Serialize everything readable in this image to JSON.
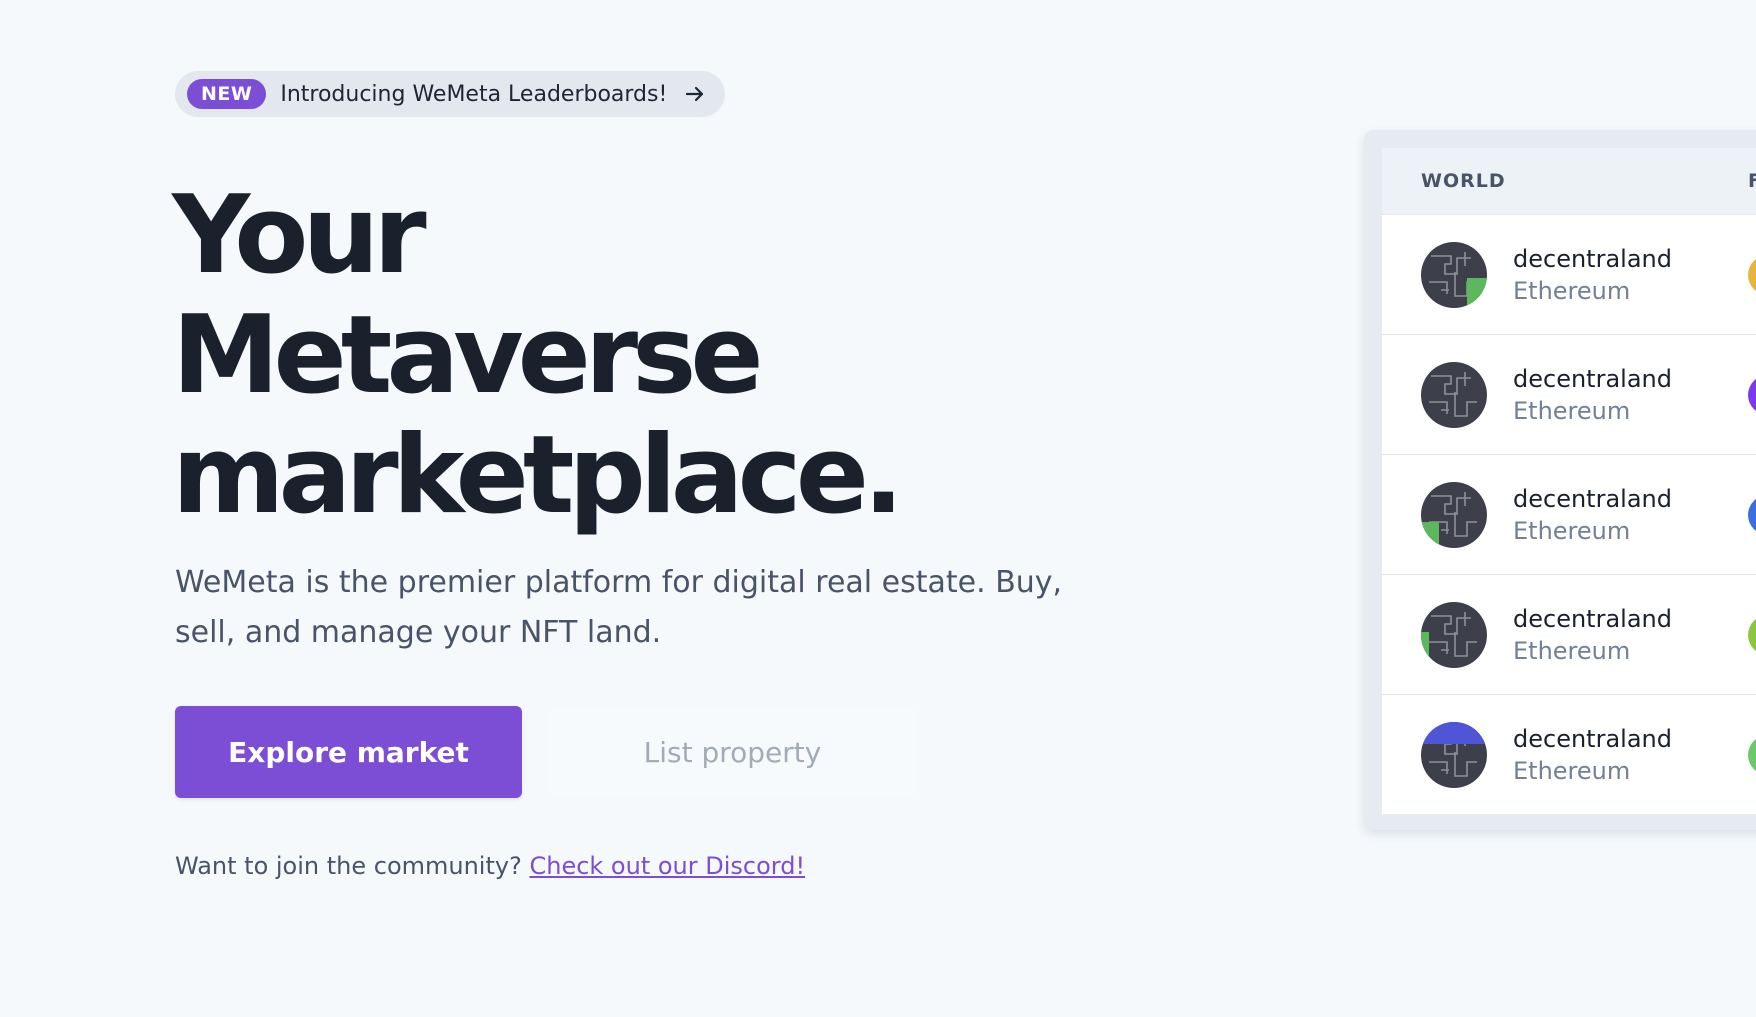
{
  "announcement": {
    "badge": "NEW",
    "text": "Introducing WeMeta Leaderboards!",
    "arrow_icon": "arrow-right-icon"
  },
  "hero": {
    "line1": "Your",
    "line2": "Metaverse",
    "line3": "marketplace.",
    "subtitle": "WeMeta is the premier platform for digital real estate. Buy, sell, and manage your NFT land."
  },
  "actions": {
    "primary_label": "Explore market",
    "secondary_label": "List property"
  },
  "community": {
    "prompt": "Want to join the community?",
    "link_text": "Check out our Discord!"
  },
  "table": {
    "header_world": "WORLD",
    "header_next": "F",
    "rows": [
      {
        "name": "decentraland",
        "chain": "Ethereum",
        "accent": "#e6b53d"
      },
      {
        "name": "decentraland",
        "chain": "Ethereum",
        "accent": "#7c3aed"
      },
      {
        "name": "decentraland",
        "chain": "Ethereum",
        "accent": "#3b6fe0"
      },
      {
        "name": "decentraland",
        "chain": "Ethereum",
        "accent": "#8cc63f"
      },
      {
        "name": "decentraland",
        "chain": "Ethereum",
        "accent": "#6cc96a"
      }
    ]
  },
  "colors": {
    "brand": "#7c4ed6",
    "background": "#f5f9fc",
    "heading": "#1a202c",
    "body_text": "#4a5468"
  }
}
